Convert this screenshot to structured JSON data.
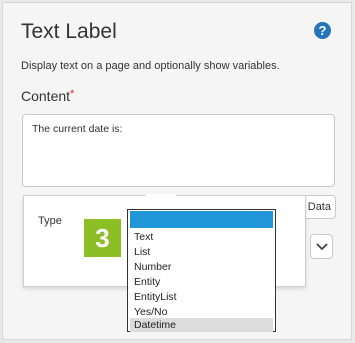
{
  "panel": {
    "title": "Text Label",
    "description": "Display text on a page and optionally show variables.",
    "content_label": "Content",
    "required_marker": "*",
    "content_value": "The current date is:",
    "insert_data_label": "Data",
    "help_symbol": "?"
  },
  "popover": {
    "type_label": "Type",
    "step_badge": "3",
    "options": [
      "Text",
      "List",
      "Number",
      "Entity",
      "EntityList",
      "Yes/No",
      "Datetime"
    ],
    "highlighted_option": "",
    "selected_option": "Datetime"
  },
  "colors": {
    "accent_blue": "#2196d9",
    "badge_green": "#8cbf26",
    "help_blue": "#2475b9",
    "required_red": "#d9232d"
  }
}
